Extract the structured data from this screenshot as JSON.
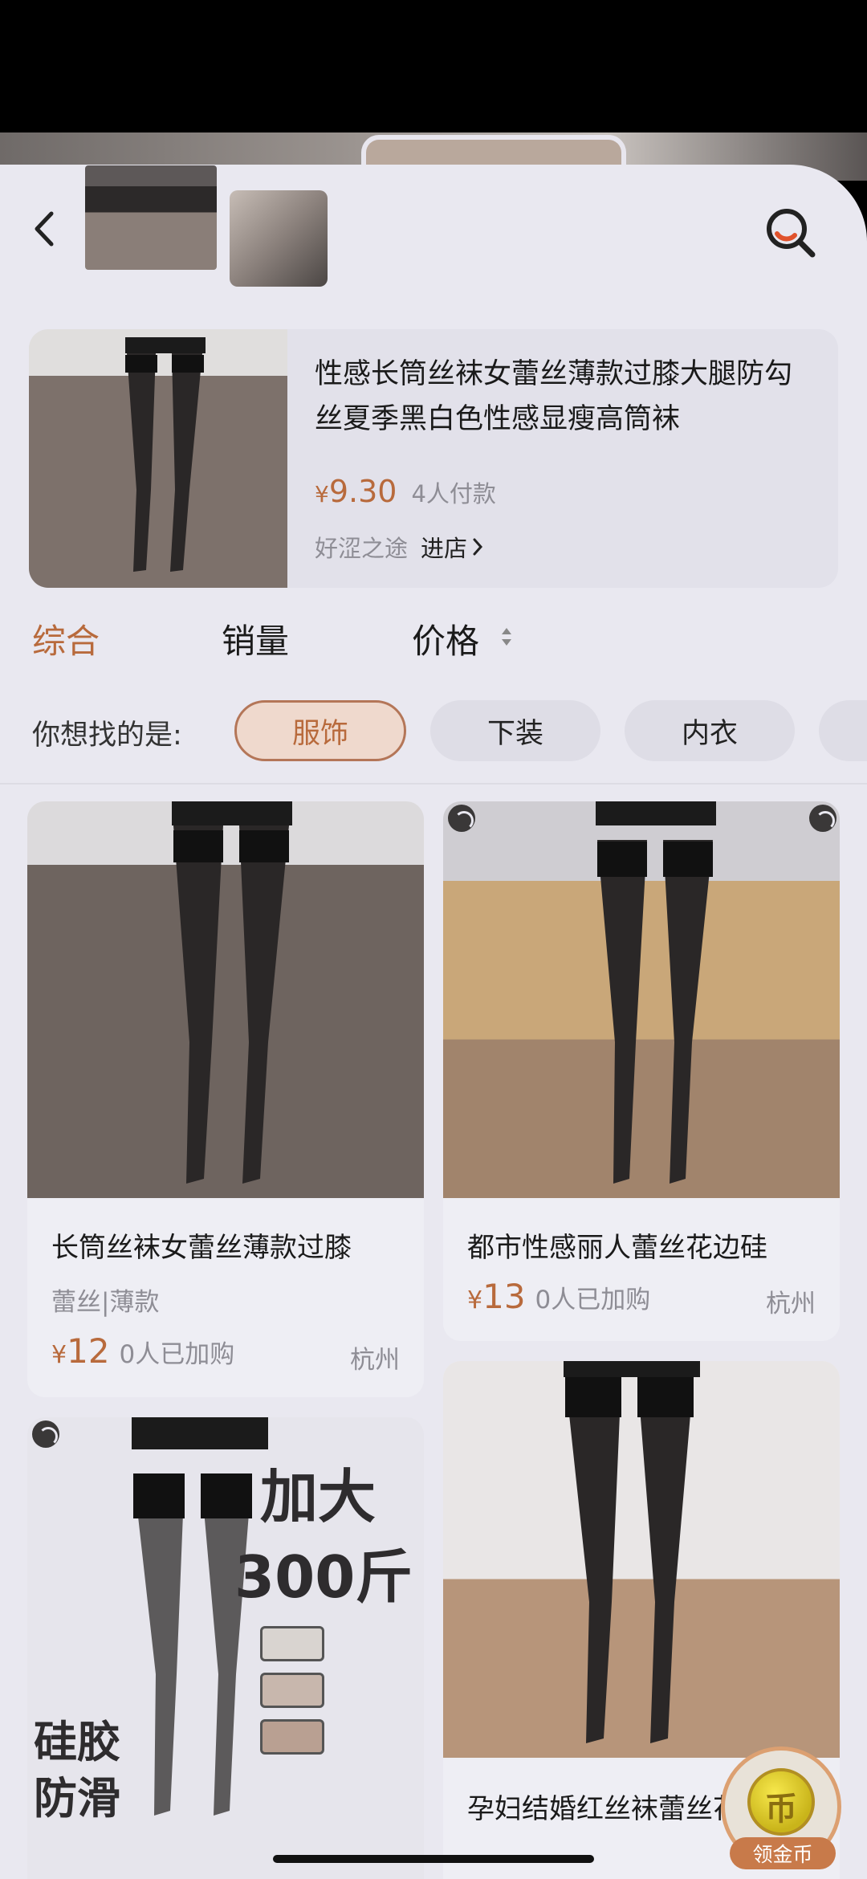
{
  "header": {
    "back_icon": "chevron-left-icon",
    "search_icon": "search-icon"
  },
  "product": {
    "title": "性感长筒丝袜女蕾丝薄款过膝大腿防勾丝夏季黑白色性感显瘦高筒袜",
    "price_symbol": "¥",
    "price": "9.30",
    "paid_count": "4人付款",
    "shop_name": "好涩之途",
    "shop_link": "进店",
    "shop_link_icon": "chevron-right-icon"
  },
  "sort": {
    "tabs": [
      "综合",
      "销量",
      "价格"
    ],
    "active": "综合"
  },
  "filter": {
    "label": "你想找的是:",
    "chips": [
      "服饰",
      "下装",
      "内衣"
    ],
    "active": "服饰"
  },
  "results": [
    {
      "title": "长筒丝袜女蕾丝薄款过膝",
      "tags": "蕾丝|薄款",
      "price_symbol": "¥",
      "price": "12",
      "sold": "0人已加购",
      "location": "杭州"
    },
    {
      "title": "都市性感丽人蕾丝花边硅",
      "price_symbol": "¥",
      "price": "13",
      "sold": "0人已加购",
      "location": "杭州"
    },
    {
      "promo_line_1": "加大",
      "promo_line_2": "300斤",
      "promo_line_3": "硅胶",
      "promo_line_4": "防滑"
    },
    {
      "title": "孕妇结婚红丝袜蕾丝花边"
    }
  ],
  "coin_widget": {
    "label": "领金币",
    "face": "币"
  },
  "colors": {
    "accent": "#b86a3c",
    "background": "#e9e8f0",
    "chip_active_bg": "#efd9cd"
  }
}
